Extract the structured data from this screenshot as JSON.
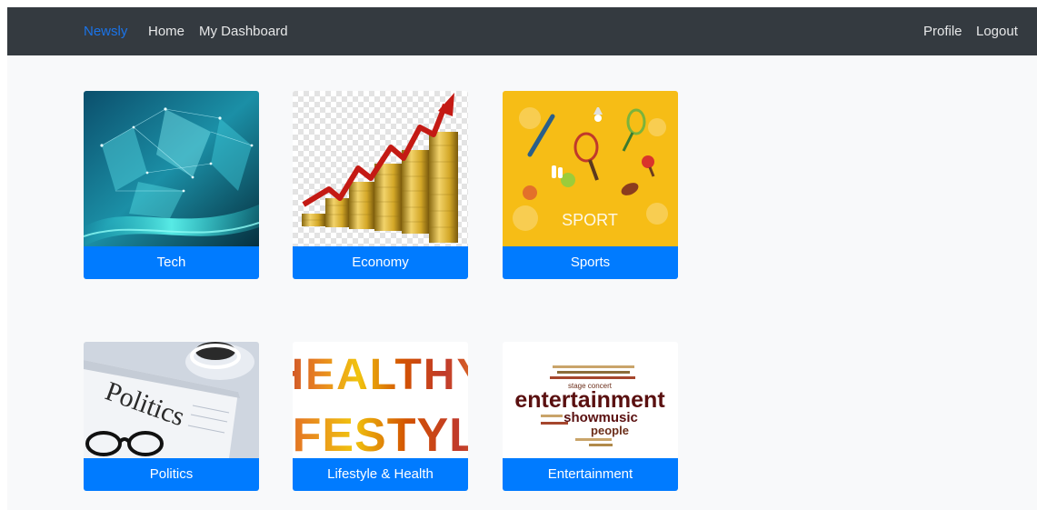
{
  "navbar": {
    "brand": "Newsly",
    "links": {
      "home": "Home",
      "dashboard": "My Dashboard",
      "profile": "Profile",
      "logout": "Logout"
    }
  },
  "categories": [
    {
      "label": "Tech"
    },
    {
      "label": "Economy"
    },
    {
      "label": "Sports"
    },
    {
      "label": "Politics"
    },
    {
      "label": "Lifestyle & Health"
    },
    {
      "label": "Entertainment"
    }
  ],
  "images": {
    "sports_text": "SPORT",
    "politics_text": "Politics",
    "lifestyle_line1": "HEALTHY",
    "lifestyle_line2": "LIFESTYLE",
    "entertainment_main": "entertainment",
    "entertainment_sub": "showmusic",
    "entertainment_sub2": "people",
    "entertainment_small": "stage concert"
  },
  "colors": {
    "navbar": "#343a40",
    "brand": "#1a73e8",
    "button": "#007bff",
    "background": "#f8f9fa",
    "sports_bg": "#f6bd16"
  }
}
